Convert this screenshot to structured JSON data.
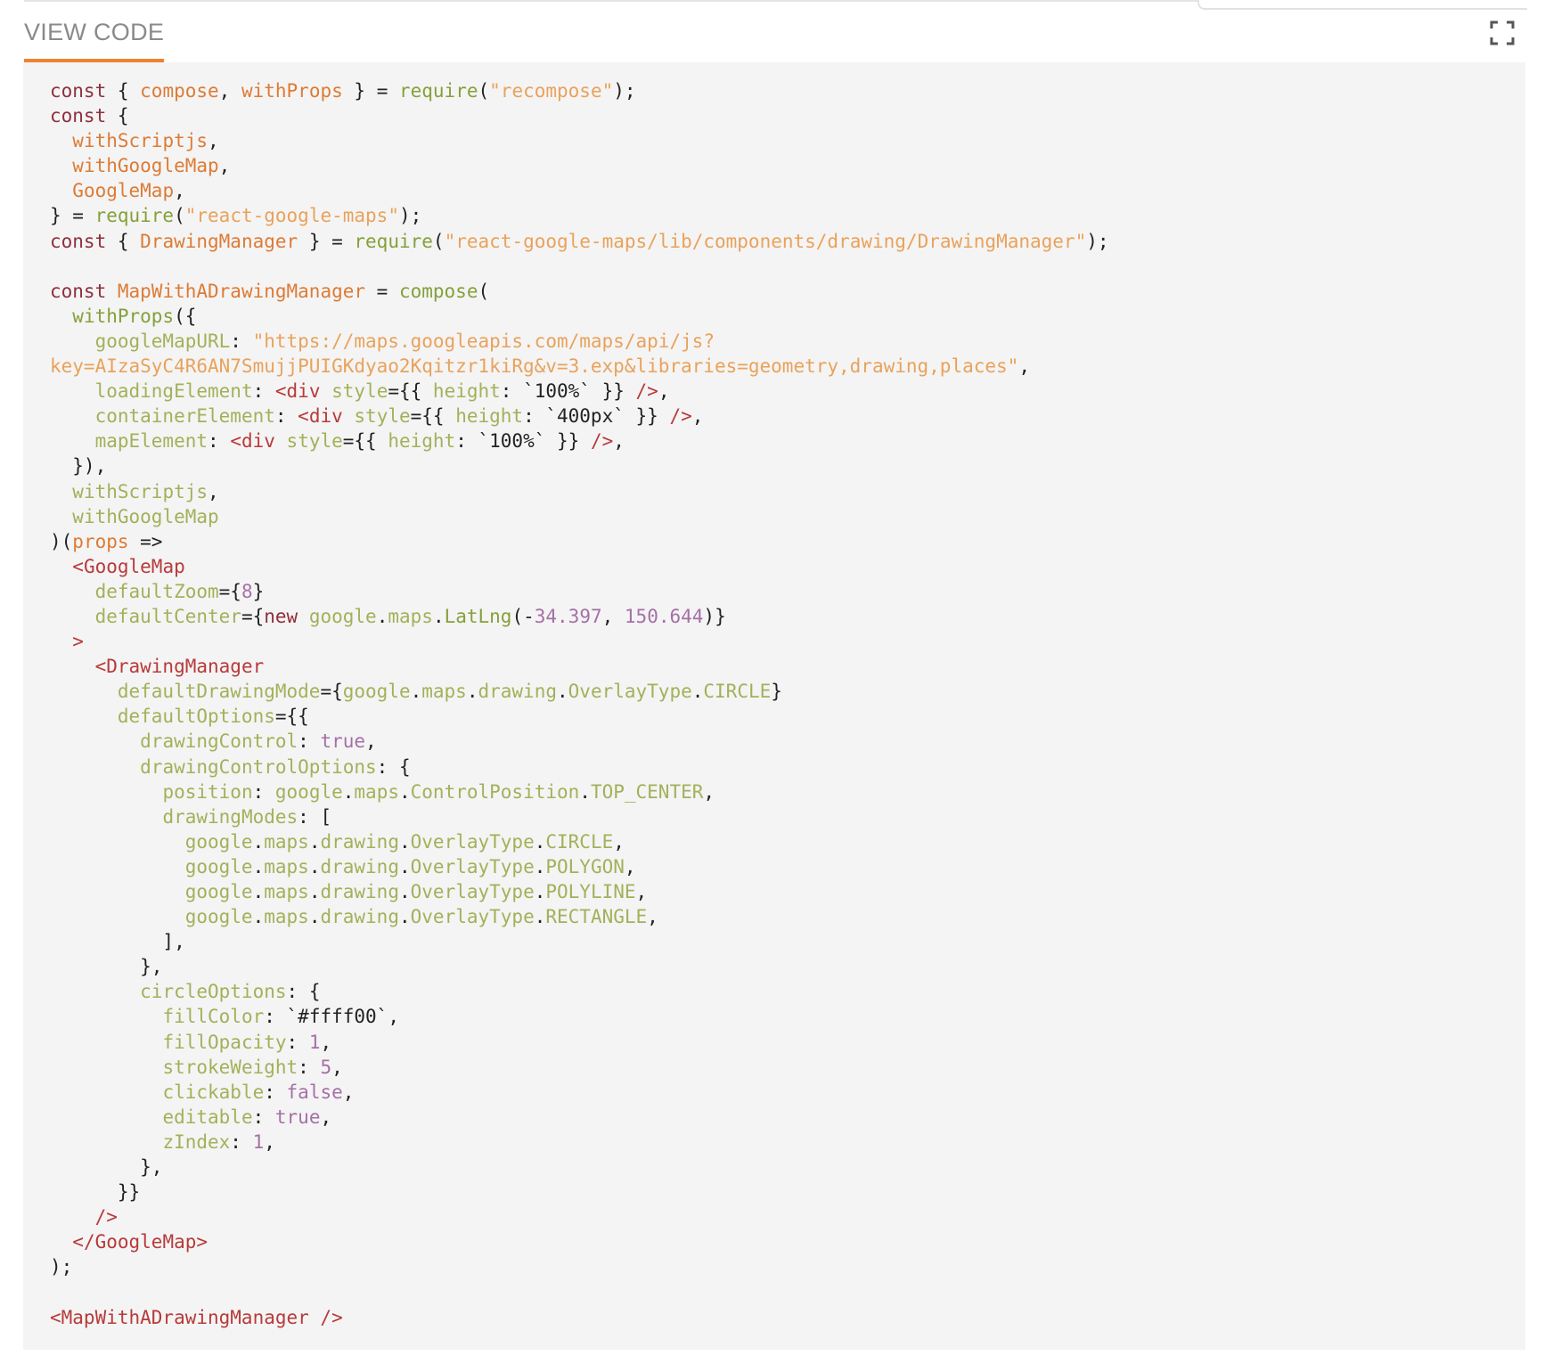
{
  "header": {
    "tab_label": "VIEW CODE",
    "expand_icon": "fullscreen-icon"
  },
  "code": {
    "language": "jsx",
    "lines": [
      [
        [
          "kw",
          "const"
        ],
        [
          "pl",
          " { "
        ],
        [
          "var",
          "compose"
        ],
        [
          "pl",
          ", "
        ],
        [
          "var",
          "withProps"
        ],
        [
          "pl",
          " } = "
        ],
        [
          "fn",
          "require"
        ],
        [
          "pl",
          "("
        ],
        [
          "str",
          "\"recompose\""
        ],
        [
          "pl",
          ");"
        ]
      ],
      [
        [
          "kw",
          "const"
        ],
        [
          "pl",
          " {"
        ]
      ],
      [
        [
          "pl",
          "  "
        ],
        [
          "var",
          "withScriptjs"
        ],
        [
          "pl",
          ","
        ]
      ],
      [
        [
          "pl",
          "  "
        ],
        [
          "var",
          "withGoogleMap"
        ],
        [
          "pl",
          ","
        ]
      ],
      [
        [
          "pl",
          "  "
        ],
        [
          "var",
          "GoogleMap"
        ],
        [
          "pl",
          ","
        ]
      ],
      [
        [
          "pl",
          "} = "
        ],
        [
          "fn",
          "require"
        ],
        [
          "pl",
          "("
        ],
        [
          "str",
          "\"react-google-maps\""
        ],
        [
          "pl",
          ");"
        ]
      ],
      [
        [
          "kw",
          "const"
        ],
        [
          "pl",
          " { "
        ],
        [
          "var",
          "DrawingManager"
        ],
        [
          "pl",
          " } = "
        ],
        [
          "fn",
          "require"
        ],
        [
          "pl",
          "("
        ],
        [
          "str",
          "\"react-google-maps/lib/components/drawing/DrawingManager\""
        ],
        [
          "pl",
          ");"
        ]
      ],
      [],
      [
        [
          "kw",
          "const"
        ],
        [
          "pl",
          " "
        ],
        [
          "var",
          "MapWithADrawingManager"
        ],
        [
          "pl",
          " = "
        ],
        [
          "fn",
          "compose"
        ],
        [
          "pl",
          "("
        ]
      ],
      [
        [
          "pl",
          "  "
        ],
        [
          "fn",
          "withProps"
        ],
        [
          "pl",
          "({"
        ]
      ],
      [
        [
          "pl",
          "    "
        ],
        [
          "prop",
          "googleMapURL"
        ],
        [
          "pl",
          ": "
        ],
        [
          "str",
          "\"https://maps.googleapis.com/maps/api/js?"
        ]
      ],
      [
        [
          "str",
          "key=AIzaSyC4R6AN7SmujjPUIGKdyao2Kqitzr1kiRg&v=3.exp&libraries=geometry,drawing,places\""
        ],
        [
          "pl",
          ","
        ]
      ],
      [
        [
          "pl",
          "    "
        ],
        [
          "prop",
          "loadingElement"
        ],
        [
          "pl",
          ": "
        ],
        [
          "tag",
          "<div"
        ],
        [
          "pl",
          " "
        ],
        [
          "prop",
          "style"
        ],
        [
          "pl",
          "={{ "
        ],
        [
          "prop",
          "height"
        ],
        [
          "pl",
          ": "
        ],
        [
          "tpl",
          "`100%`"
        ],
        [
          "pl",
          " }} "
        ],
        [
          "tag",
          "/>"
        ],
        [
          "pl",
          ","
        ]
      ],
      [
        [
          "pl",
          "    "
        ],
        [
          "prop",
          "containerElement"
        ],
        [
          "pl",
          ": "
        ],
        [
          "tag",
          "<div"
        ],
        [
          "pl",
          " "
        ],
        [
          "prop",
          "style"
        ],
        [
          "pl",
          "={{ "
        ],
        [
          "prop",
          "height"
        ],
        [
          "pl",
          ": "
        ],
        [
          "tpl",
          "`400px`"
        ],
        [
          "pl",
          " }} "
        ],
        [
          "tag",
          "/>"
        ],
        [
          "pl",
          ","
        ]
      ],
      [
        [
          "pl",
          "    "
        ],
        [
          "prop",
          "mapElement"
        ],
        [
          "pl",
          ": "
        ],
        [
          "tag",
          "<div"
        ],
        [
          "pl",
          " "
        ],
        [
          "prop",
          "style"
        ],
        [
          "pl",
          "={{ "
        ],
        [
          "prop",
          "height"
        ],
        [
          "pl",
          ": "
        ],
        [
          "tpl",
          "`100%`"
        ],
        [
          "pl",
          " }} "
        ],
        [
          "tag",
          "/>"
        ],
        [
          "pl",
          ","
        ]
      ],
      [
        [
          "pl",
          "  }),"
        ]
      ],
      [
        [
          "pl",
          "  "
        ],
        [
          "prop",
          "withScriptjs"
        ],
        [
          "pl",
          ","
        ]
      ],
      [
        [
          "pl",
          "  "
        ],
        [
          "prop",
          "withGoogleMap"
        ]
      ],
      [
        [
          "pl",
          ")("
        ],
        [
          "var",
          "props"
        ],
        [
          "pl",
          " =>"
        ]
      ],
      [
        [
          "pl",
          "  "
        ],
        [
          "tag",
          "<GoogleMap"
        ]
      ],
      [
        [
          "pl",
          "    "
        ],
        [
          "prop",
          "defaultZoom"
        ],
        [
          "pl",
          "={"
        ],
        [
          "num",
          "8"
        ],
        [
          "pl",
          "}"
        ]
      ],
      [
        [
          "pl",
          "    "
        ],
        [
          "prop",
          "defaultCenter"
        ],
        [
          "pl",
          "={"
        ],
        [
          "kw",
          "new"
        ],
        [
          "pl",
          " "
        ],
        [
          "prop",
          "google"
        ],
        [
          "pl",
          "."
        ],
        [
          "prop",
          "maps"
        ],
        [
          "pl",
          "."
        ],
        [
          "fn",
          "LatLng"
        ],
        [
          "pl",
          "(-"
        ],
        [
          "num",
          "34.397"
        ],
        [
          "pl",
          ", "
        ],
        [
          "num",
          "150.644"
        ],
        [
          "pl",
          ")}"
        ]
      ],
      [
        [
          "pl",
          "  "
        ],
        [
          "tag",
          ">"
        ]
      ],
      [
        [
          "pl",
          "    "
        ],
        [
          "tag",
          "<DrawingManager"
        ]
      ],
      [
        [
          "pl",
          "      "
        ],
        [
          "prop",
          "defaultDrawingMode"
        ],
        [
          "pl",
          "={"
        ],
        [
          "prop",
          "google"
        ],
        [
          "pl",
          "."
        ],
        [
          "prop",
          "maps"
        ],
        [
          "pl",
          "."
        ],
        [
          "prop",
          "drawing"
        ],
        [
          "pl",
          "."
        ],
        [
          "prop",
          "OverlayType"
        ],
        [
          "pl",
          "."
        ],
        [
          "prop",
          "CIRCLE"
        ],
        [
          "pl",
          "}"
        ]
      ],
      [
        [
          "pl",
          "      "
        ],
        [
          "prop",
          "defaultOptions"
        ],
        [
          "pl",
          "={{"
        ]
      ],
      [
        [
          "pl",
          "        "
        ],
        [
          "prop",
          "drawingControl"
        ],
        [
          "pl",
          ": "
        ],
        [
          "num",
          "true"
        ],
        [
          "pl",
          ","
        ]
      ],
      [
        [
          "pl",
          "        "
        ],
        [
          "prop",
          "drawingControlOptions"
        ],
        [
          "pl",
          ": {"
        ]
      ],
      [
        [
          "pl",
          "          "
        ],
        [
          "prop",
          "position"
        ],
        [
          "pl",
          ": "
        ],
        [
          "prop",
          "google"
        ],
        [
          "pl",
          "."
        ],
        [
          "prop",
          "maps"
        ],
        [
          "pl",
          "."
        ],
        [
          "prop",
          "ControlPosition"
        ],
        [
          "pl",
          "."
        ],
        [
          "prop",
          "TOP_CENTER"
        ],
        [
          "pl",
          ","
        ]
      ],
      [
        [
          "pl",
          "          "
        ],
        [
          "prop",
          "drawingModes"
        ],
        [
          "pl",
          ": ["
        ]
      ],
      [
        [
          "pl",
          "            "
        ],
        [
          "prop",
          "google"
        ],
        [
          "pl",
          "."
        ],
        [
          "prop",
          "maps"
        ],
        [
          "pl",
          "."
        ],
        [
          "prop",
          "drawing"
        ],
        [
          "pl",
          "."
        ],
        [
          "prop",
          "OverlayType"
        ],
        [
          "pl",
          "."
        ],
        [
          "prop",
          "CIRCLE"
        ],
        [
          "pl",
          ","
        ]
      ],
      [
        [
          "pl",
          "            "
        ],
        [
          "prop",
          "google"
        ],
        [
          "pl",
          "."
        ],
        [
          "prop",
          "maps"
        ],
        [
          "pl",
          "."
        ],
        [
          "prop",
          "drawing"
        ],
        [
          "pl",
          "."
        ],
        [
          "prop",
          "OverlayType"
        ],
        [
          "pl",
          "."
        ],
        [
          "prop",
          "POLYGON"
        ],
        [
          "pl",
          ","
        ]
      ],
      [
        [
          "pl",
          "            "
        ],
        [
          "prop",
          "google"
        ],
        [
          "pl",
          "."
        ],
        [
          "prop",
          "maps"
        ],
        [
          "pl",
          "."
        ],
        [
          "prop",
          "drawing"
        ],
        [
          "pl",
          "."
        ],
        [
          "prop",
          "OverlayType"
        ],
        [
          "pl",
          "."
        ],
        [
          "prop",
          "POLYLINE"
        ],
        [
          "pl",
          ","
        ]
      ],
      [
        [
          "pl",
          "            "
        ],
        [
          "prop",
          "google"
        ],
        [
          "pl",
          "."
        ],
        [
          "prop",
          "maps"
        ],
        [
          "pl",
          "."
        ],
        [
          "prop",
          "drawing"
        ],
        [
          "pl",
          "."
        ],
        [
          "prop",
          "OverlayType"
        ],
        [
          "pl",
          "."
        ],
        [
          "prop",
          "RECTANGLE"
        ],
        [
          "pl",
          ","
        ]
      ],
      [
        [
          "pl",
          "          ],"
        ]
      ],
      [
        [
          "pl",
          "        },"
        ]
      ],
      [
        [
          "pl",
          "        "
        ],
        [
          "prop",
          "circleOptions"
        ],
        [
          "pl",
          ": {"
        ]
      ],
      [
        [
          "pl",
          "          "
        ],
        [
          "prop",
          "fillColor"
        ],
        [
          "pl",
          ": "
        ],
        [
          "tpl",
          "`#ffff00`"
        ],
        [
          "pl",
          ","
        ]
      ],
      [
        [
          "pl",
          "          "
        ],
        [
          "prop",
          "fillOpacity"
        ],
        [
          "pl",
          ": "
        ],
        [
          "num",
          "1"
        ],
        [
          "pl",
          ","
        ]
      ],
      [
        [
          "pl",
          "          "
        ],
        [
          "prop",
          "strokeWeight"
        ],
        [
          "pl",
          ": "
        ],
        [
          "num",
          "5"
        ],
        [
          "pl",
          ","
        ]
      ],
      [
        [
          "pl",
          "          "
        ],
        [
          "prop",
          "clickable"
        ],
        [
          "pl",
          ": "
        ],
        [
          "num",
          "false"
        ],
        [
          "pl",
          ","
        ]
      ],
      [
        [
          "pl",
          "          "
        ],
        [
          "prop",
          "editable"
        ],
        [
          "pl",
          ": "
        ],
        [
          "num",
          "true"
        ],
        [
          "pl",
          ","
        ]
      ],
      [
        [
          "pl",
          "          "
        ],
        [
          "prop",
          "zIndex"
        ],
        [
          "pl",
          ": "
        ],
        [
          "num",
          "1"
        ],
        [
          "pl",
          ","
        ]
      ],
      [
        [
          "pl",
          "        },"
        ]
      ],
      [
        [
          "pl",
          "      }}"
        ]
      ],
      [
        [
          "pl",
          "    "
        ],
        [
          "tag",
          "/>"
        ]
      ],
      [
        [
          "pl",
          "  "
        ],
        [
          "tag",
          "</GoogleMap>"
        ]
      ],
      [
        [
          "pl",
          ");"
        ]
      ],
      [],
      [
        [
          "tag",
          "<MapWithADrawingManager />"
        ]
      ]
    ]
  }
}
